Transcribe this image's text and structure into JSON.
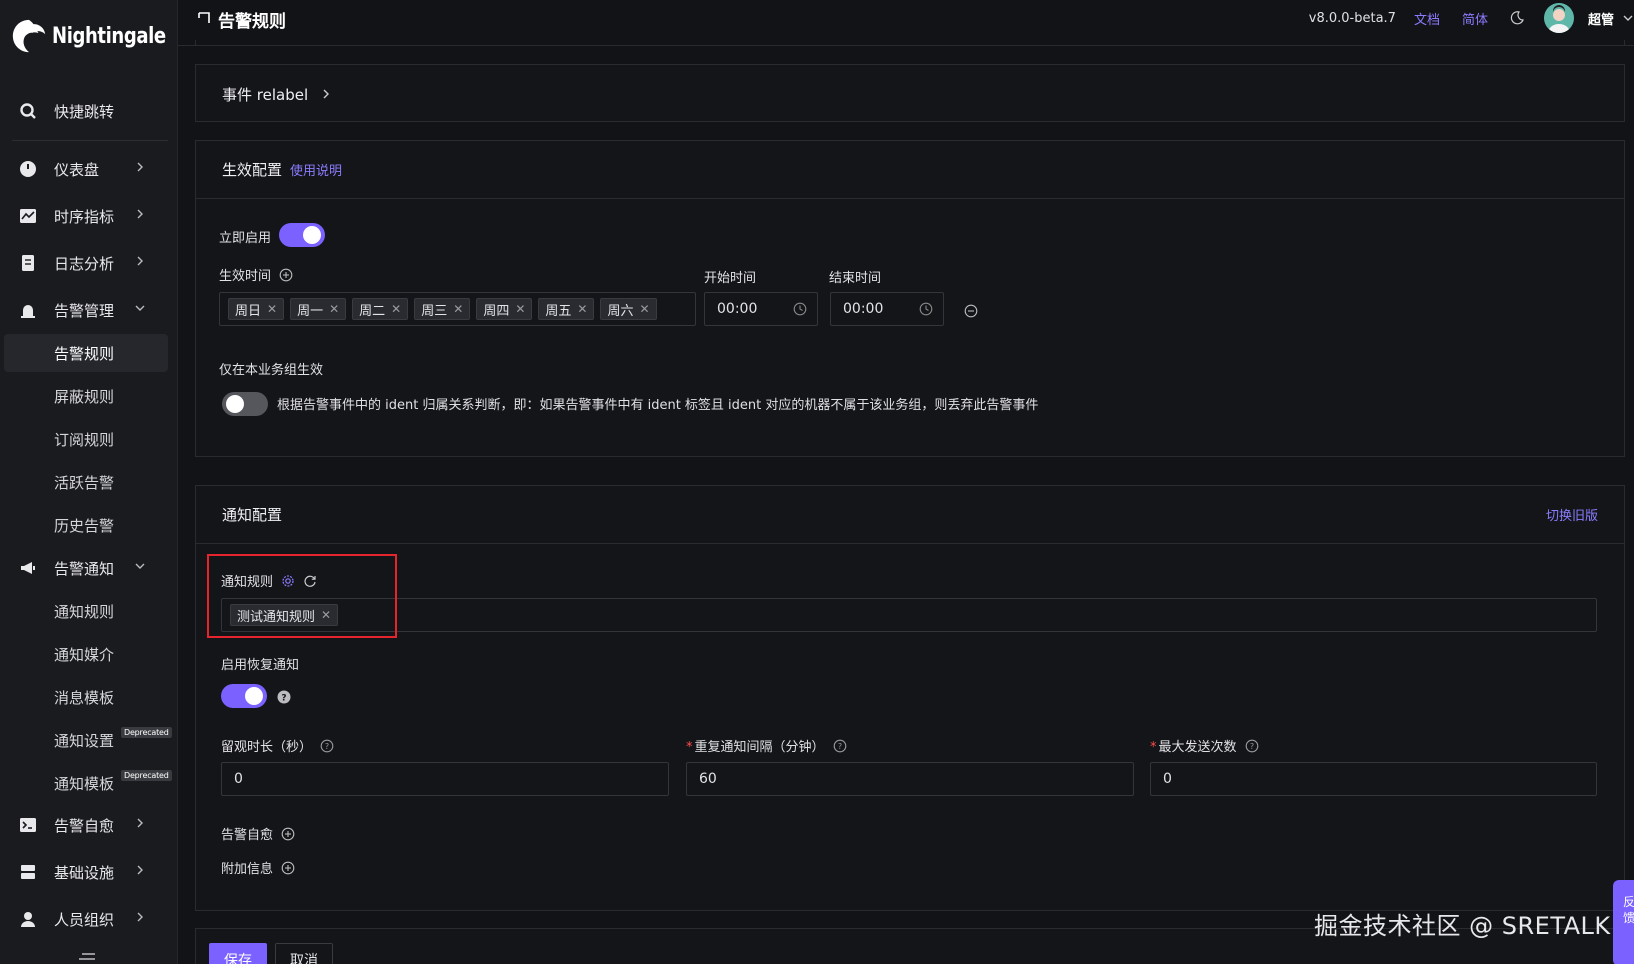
{
  "app": {
    "name": "Nightingale",
    "page_title": "告警规则"
  },
  "header": {
    "version": "v8.0.0-beta.7",
    "docs": "文档",
    "lang": "简体",
    "user": "超管"
  },
  "sidebar": {
    "quick": "快捷跳转",
    "items": [
      {
        "label": "仪表盘"
      },
      {
        "label": "时序指标"
      },
      {
        "label": "日志分析"
      },
      {
        "label": "告警管理"
      }
    ],
    "alert_sub": [
      "告警规则",
      "屏蔽规则",
      "订阅规则",
      "活跃告警",
      "历史告警"
    ],
    "notify": "告警通知",
    "notify_sub": [
      "通知规则",
      "通知媒介",
      "消息模板",
      "通知设置",
      "通知模板"
    ],
    "deprecated": "Deprecated",
    "bottom": [
      "告警自愈",
      "基础设施",
      "人员组织"
    ]
  },
  "relabel": {
    "title": "事件 relabel"
  },
  "effective": {
    "title": "生效配置",
    "help_link": "使用说明",
    "enable_now": "立即启用",
    "effective_time": "生效时间",
    "days": [
      "周日",
      "周一",
      "周二",
      "周三",
      "周四",
      "周五",
      "周六"
    ],
    "start_label": "开始时间",
    "end_label": "结束时间",
    "start_value": "00:00",
    "end_value": "00:00",
    "bg_only_label": "仅在本业务组生效",
    "bg_only_hint": "根据告警事件中的 ident 归属关系判断，即：如果告警事件中有 ident 标签且 ident 对应的机器不属于该业务组，则丢弃此告警事件"
  },
  "notify": {
    "title": "通知配置",
    "switch_old": "切换旧版",
    "rules_label": "通知规则",
    "rule_tag": "测试通知规则",
    "recovery_label": "启用恢复通知",
    "observe_label": "留观时长（秒）",
    "observe_value": "0",
    "repeat_label": "重复通知间隔（分钟）",
    "repeat_value": "60",
    "max_label": "最大发送次数",
    "max_value": "0",
    "self_heal": "告警自愈",
    "extra_info": "附加信息"
  },
  "actions": {
    "save": "保存",
    "cancel": "取消"
  },
  "watermark": "掘金技术社区 @ SRETALK",
  "float_tab": "反馈",
  "colors": {
    "accent": "#7b61ff",
    "highlight": "#e5242c",
    "background": "#121316"
  }
}
